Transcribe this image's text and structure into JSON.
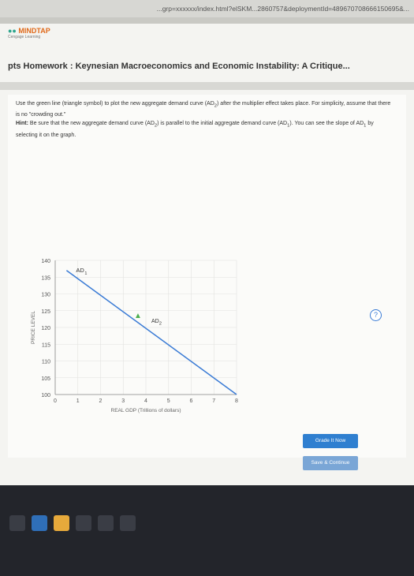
{
  "url": "...grp=xxxxxx/index.html?elSKM...2860757&deploymentId=489670708666150695&...",
  "brand": {
    "name": "MINDTAP",
    "tagline": "Cengage Learning"
  },
  "page_title": "pts Homework : Keynesian Macroeconomics and Economic Instability: A Critique...",
  "instructions": {
    "line1": "Use the green line (triangle symbol) to plot the new aggregate demand curve (AD",
    "line1_sub": "2",
    "line1_rest": ") after the multiplier effect takes place. For simplicity, assume that there is no \"crowding out.\"",
    "hint_label": "Hint:",
    "hint": "Be sure that the new aggregate demand curve (AD",
    "hint_sub": "2",
    "hint_rest": ") is parallel to the initial aggregate demand curve (AD",
    "hint_sub1": "1",
    "hint_end": "). You can see the slope of AD",
    "hint_end_sub": "1",
    "hint_tail": " by selecting it on the graph."
  },
  "help_symbol": "?",
  "palette": {
    "symbol": "triangle",
    "label": "AD",
    "label_sub": "2"
  },
  "chart_data": {
    "type": "line",
    "ylabel": "PRICE LEVEL",
    "xlabel": "REAL GDP (Trillions of dollars)",
    "y_ticks": [
      100,
      105,
      110,
      115,
      120,
      125,
      130,
      135,
      140
    ],
    "x_ticks": [
      0,
      1,
      2,
      3,
      4,
      5,
      6,
      7,
      8
    ],
    "ylim": [
      100,
      140
    ],
    "xlim": [
      0,
      8
    ],
    "series": [
      {
        "name": "AD1",
        "x": [
          0.5,
          8
        ],
        "y": [
          137,
          100
        ]
      }
    ],
    "series_label": "AD",
    "series_label_sub": "1"
  },
  "buttons": {
    "grade": "Grade It Now",
    "continue": "Save & Continue"
  },
  "colors": {
    "accent": "#2f7fd0",
    "green": "#4caf50",
    "ad1": "#3a7bd5"
  },
  "taskbar_icons": [
    "start-icon",
    "edge-icon",
    "folder-icon",
    "store-icon",
    "mail-icon",
    "hp-icon"
  ]
}
